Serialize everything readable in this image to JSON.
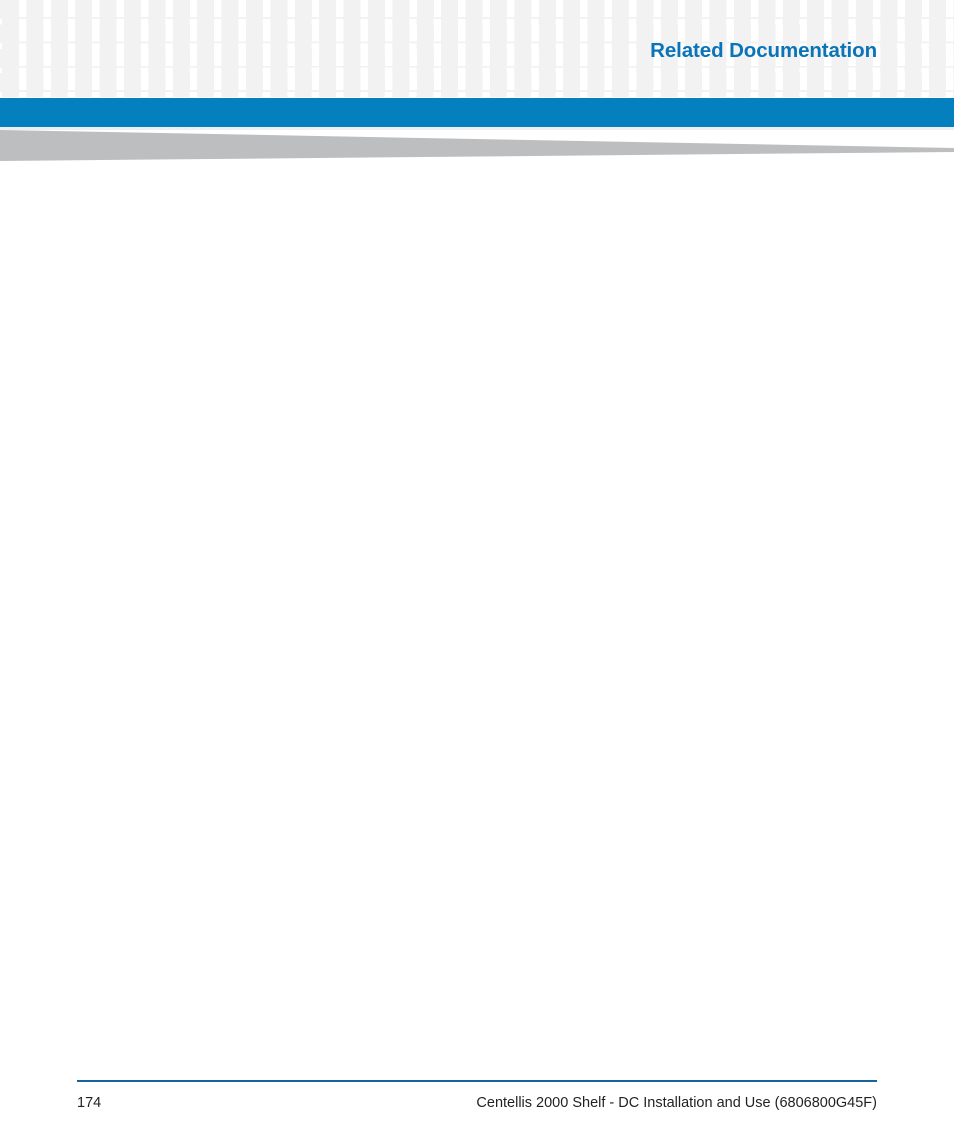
{
  "document": {
    "page_type": "chapter-divider-page",
    "background_color": "#ffffff"
  },
  "header": {
    "title": "Related Documentation",
    "title_color": "#0a74b9",
    "band_color": "#0580bf",
    "swoosh_color": "#bcbec0",
    "grid_square_color": "#f2f2f2",
    "grid_rows": 4
  },
  "body": {
    "content": ""
  },
  "footer": {
    "page_number": "174",
    "document_title": "Centellis 2000 Shelf - DC Installation and Use (6806800G45F)",
    "rule_color": "#1763a0",
    "text_color": "#231f20"
  }
}
